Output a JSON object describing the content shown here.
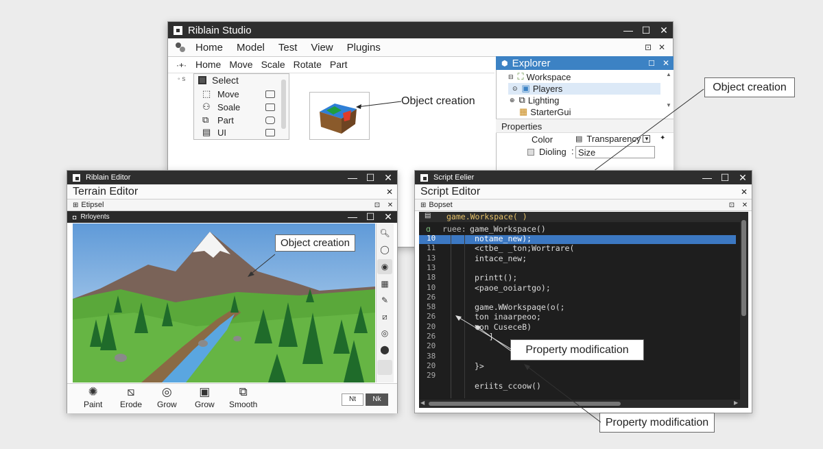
{
  "studio": {
    "title": "Riblain Studio",
    "menu": [
      "Home",
      "Model",
      "Test",
      "View",
      "Plugins"
    ],
    "toolbar": [
      "Home",
      "Move",
      "Scale",
      "Rotate",
      "Part"
    ],
    "tools": [
      "Select",
      "Move",
      "Soale",
      "Part",
      "UI"
    ],
    "object_callout": "Object creation",
    "explorer": {
      "title": "Explorer",
      "items": [
        "Workspace",
        "Players",
        "Lighting",
        "StarterGui"
      ]
    },
    "properties": {
      "title": "Properties",
      "color_label": "Color",
      "transparency_label": "Transparency",
      "dioling_label": "Dioling",
      "size_value": "Size"
    }
  },
  "outer_callouts": {
    "object_creation": "Object creation",
    "property_modification_bottom": "Property modification"
  },
  "terrain": {
    "window_title": "Riblain Editor",
    "header": "Terrain Editor",
    "subheader": "Etipsel",
    "viewport_title": "Rrloyents",
    "callout": "Object creation",
    "bottom_tools": [
      "Paint",
      "Erode",
      "Grow",
      "Grow",
      "Smooth"
    ],
    "btn1": "Nt",
    "btn2": "Nk"
  },
  "script": {
    "window_title": "Script Eelier",
    "header": "Script Editor",
    "subheader": "Bopset",
    "line_top1": "game.Workspace( )",
    "line_top2": "game_Workspace()",
    "line_top2_prefix": "ruee:",
    "line_numbers": [
      "10",
      "11",
      "13",
      "13",
      "18",
      "10",
      "26",
      "58",
      "26",
      "20",
      "26",
      "20",
      "38",
      "20",
      "29"
    ],
    "code_lines": [
      "notame_new);",
      "<ctbe_ _ton;Wortrare(",
      "intace_new;",
      "",
      "printt();",
      "<paoe_ooiartgo);",
      "",
      "game.WWorkspaqe(o(;",
      "ton inaarpeoo;",
      "con CuseceB)",
      "   ]",
      "",
      "",
      "}>",
      "",
      "eriits_ccoow()"
    ],
    "callout": "Property modification"
  }
}
